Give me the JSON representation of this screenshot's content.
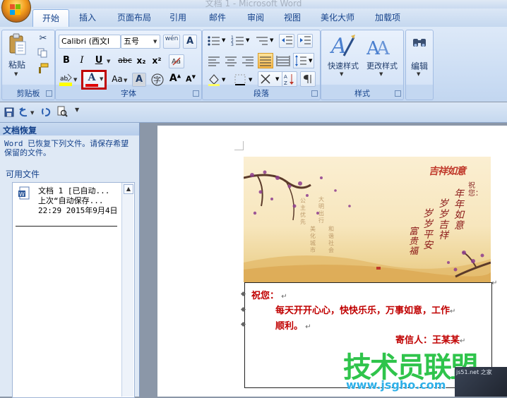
{
  "window": {
    "title": "文档 1 - Microsoft Word"
  },
  "tabs": [
    "开始",
    "插入",
    "页面布局",
    "引用",
    "邮件",
    "审阅",
    "视图",
    "美化大师",
    "加载项"
  ],
  "ribbon": {
    "clipboard": {
      "label": "剪贴板",
      "paste": "粘贴"
    },
    "font": {
      "label": "字体",
      "font_name": "Calibri (西文I",
      "font_size": "五号",
      "bold": "B",
      "italic": "I",
      "underline": "U",
      "strike": "abc",
      "subscript": "x₂",
      "superscript": "x²",
      "font_color_letter": "A",
      "change_case": "Aa",
      "grow": "A",
      "shrink": "A",
      "char_shading": "A",
      "enclose": "字",
      "phonetic": "wén"
    },
    "paragraph": {
      "label": "段落"
    },
    "styles": {
      "label": "样式",
      "quick_styles": "快速样式",
      "change_styles": "更改样式"
    },
    "editing": {
      "label": "编辑"
    }
  },
  "recovery": {
    "title": "文档恢复",
    "message": "Word 已恢复下列文件。请保存希望保留的文件。",
    "available_label": "可用文件",
    "item": {
      "line1": "文档 1  [已自动...",
      "line2": "上次“自动保存...",
      "line3": "22:29 2015年9月4日"
    }
  },
  "document": {
    "card": {
      "title_glyph": "吉祥如意",
      "greeting": "祝您：",
      "vertical_lines": [
        "年年如意",
        "岁岁吉祥",
        "岁岁平安",
        "富贵福"
      ],
      "faint_lines": [
        "公主优先",
        "美化城市",
        "大明出行",
        "和谐社会"
      ]
    },
    "letter": {
      "greeting": "祝您：",
      "body_line1": "每天开开心心，快快乐乐，万事如意，工作",
      "body_line2": "顺利。",
      "signature": "寄信人：王某某"
    }
  },
  "watermark": {
    "logo": "技术员联盟",
    "site": "www.jsgho.com",
    "corner": "js51.net 之家"
  },
  "colors": {
    "accent_red": "#c00000",
    "ribbon_blue": "#15428b",
    "highlight_border": "#c00000"
  }
}
